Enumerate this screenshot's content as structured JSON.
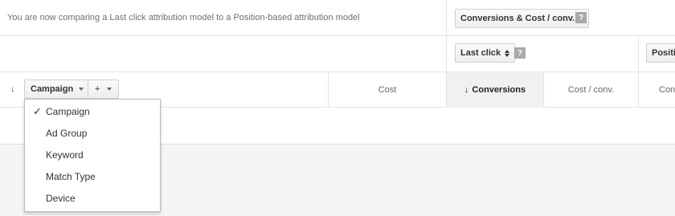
{
  "header": {
    "compare_text": "You are now comparing a Last click attribution model to a Position-based attribution model",
    "metric_select": "Conversions & Cost / conv.",
    "help": "?"
  },
  "models": {
    "left_model": "Last click",
    "right_model": "Positio",
    "help": "?"
  },
  "columns": {
    "sort_arrow": "↓",
    "segment_button": "Campaign",
    "add_button": "+",
    "cost": "Cost",
    "conversions_arrow": "↓",
    "conversions": "Conversions",
    "cost_per_conv": "Cost / conv.",
    "conv_partial": "Conv"
  },
  "dropdown": {
    "checkmark": "✓",
    "items": [
      {
        "label": "Campaign",
        "checked": true
      },
      {
        "label": "Ad Group",
        "checked": false
      },
      {
        "label": "Keyword",
        "checked": false
      },
      {
        "label": "Match Type",
        "checked": false
      },
      {
        "label": "Device",
        "checked": false
      }
    ]
  }
}
